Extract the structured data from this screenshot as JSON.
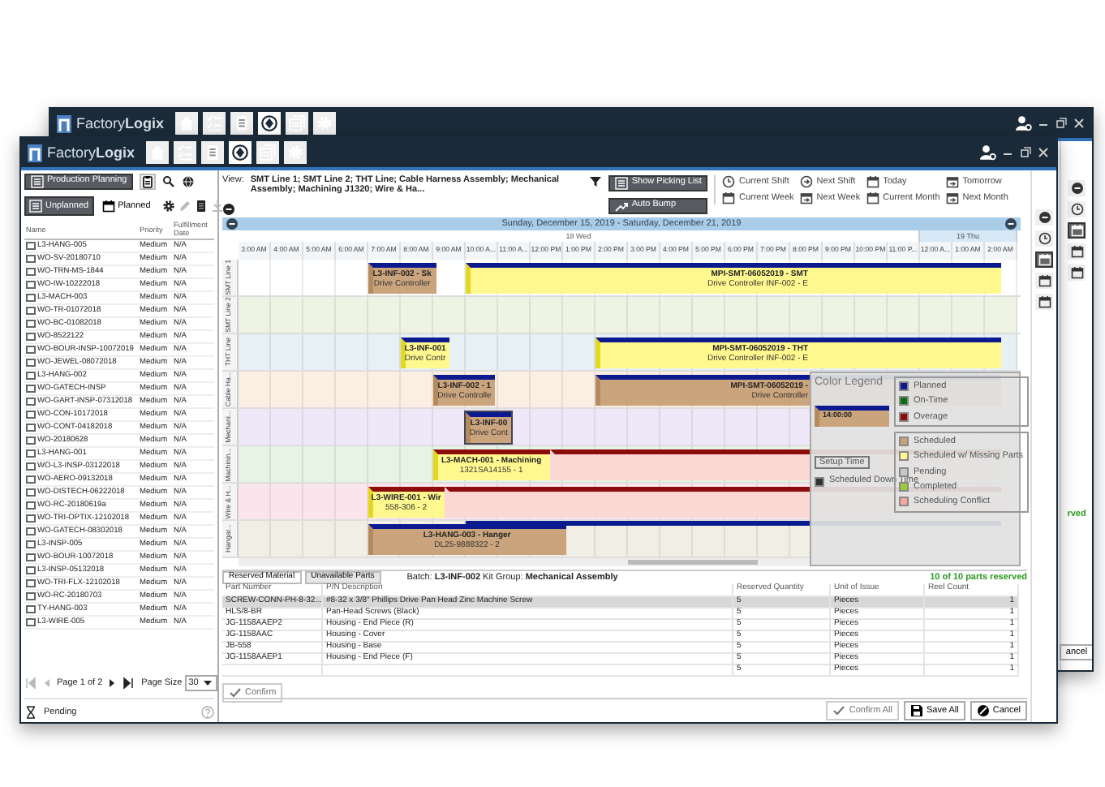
{
  "back_window": {
    "logo": "Factory**Logix**",
    "nav_icons": [
      {
        "kind": "home",
        "selected": false
      },
      {
        "kind": "checklist",
        "selected": false
      },
      {
        "kind": "document",
        "selected": false
      },
      {
        "kind": "planning",
        "selected": true
      },
      {
        "kind": "windows",
        "selected": false
      },
      {
        "kind": "gear",
        "selected": false
      }
    ],
    "side_icons": [
      {
        "kind": "collapse",
        "selected": false
      },
      {
        "kind": "clock",
        "selected": false
      },
      {
        "kind": "calendar",
        "selected": true
      },
      {
        "kind": "calendar",
        "selected": false
      },
      {
        "kind": "calendar",
        "selected": false
      }
    ],
    "status_fragment": "rved",
    "cancel_fragment": "ancel"
  },
  "window": {
    "logo": "Factory**Logix**",
    "nav_icons": [
      {
        "kind": "home",
        "selected": false
      },
      {
        "kind": "checklist",
        "selected": false
      },
      {
        "kind": "document",
        "selected": false
      },
      {
        "kind": "planning",
        "selected": true
      },
      {
        "kind": "windows",
        "selected": false
      },
      {
        "kind": "gear",
        "selected": false
      }
    ],
    "side_icons": [
      {
        "kind": "collapse",
        "selected": false
      },
      {
        "kind": "clock",
        "selected": false
      },
      {
        "kind": "calendar",
        "selected": true
      },
      {
        "kind": "calendar",
        "selected": false
      },
      {
        "kind": "calendar",
        "selected": false
      }
    ]
  },
  "left_panel": {
    "mode_button": "Production Planning",
    "tabs": [
      {
        "label": "Unplanned",
        "selected": true
      },
      {
        "label": "Planned",
        "selected": false
      }
    ],
    "tools": [
      {
        "kind": "gear",
        "disabled": false
      },
      {
        "kind": "pencil",
        "disabled": true
      },
      {
        "kind": "document",
        "disabled": false
      },
      {
        "kind": "download",
        "disabled": true
      }
    ],
    "columns": [
      "Name",
      "Priority",
      "Fulfillment Date"
    ],
    "rows": [
      {
        "name": "L3-HANG-005",
        "priority": "Medium",
        "date": "N/A",
        "checked": false
      },
      {
        "name": "WO-SV-20180710",
        "priority": "Medium",
        "date": "N/A",
        "checked": false
      },
      {
        "name": "WO-TRN-MS-1844",
        "priority": "Medium",
        "date": "N/A",
        "checked": false
      },
      {
        "name": "WO-IW-10222018",
        "priority": "Medium",
        "date": "N/A",
        "checked": false
      },
      {
        "name": "L3-MACH-003",
        "priority": "Medium",
        "date": "N/A",
        "checked": false
      },
      {
        "name": "WO-TR-01072018",
        "priority": "Medium",
        "date": "N/A",
        "checked": false
      },
      {
        "name": "WO-BC-01082018",
        "priority": "Medium",
        "date": "N/A",
        "checked": false
      },
      {
        "name": "WO-8522122",
        "priority": "Medium",
        "date": "N/A",
        "checked": false
      },
      {
        "name": "WO-BOUR-INSP-10072019",
        "priority": "Medium",
        "date": "N/A",
        "checked": false
      },
      {
        "name": "WO-JEWEL-08072018",
        "priority": "Medium",
        "date": "N/A",
        "checked": false
      },
      {
        "name": "L3-HANG-002",
        "priority": "Medium",
        "date": "N/A",
        "checked": false
      },
      {
        "name": "WO-GATECH-INSP",
        "priority": "Medium",
        "date": "N/A",
        "checked": false
      },
      {
        "name": "WO-GART-INSP-07312018",
        "priority": "Medium",
        "date": "N/A",
        "checked": false
      },
      {
        "name": "WO-CON-10172018",
        "priority": "Medium",
        "date": "N/A",
        "checked": false
      },
      {
        "name": "WO-CONT-04182018",
        "priority": "Medium",
        "date": "N/A",
        "checked": false
      },
      {
        "name": "WO-20180628",
        "priority": "Medium",
        "date": "N/A",
        "checked": false
      },
      {
        "name": "L3-HANG-001",
        "priority": "Medium",
        "date": "N/A",
        "checked": false
      },
      {
        "name": "WO-L3-INSP-03122018",
        "priority": "Medium",
        "date": "N/A",
        "checked": false
      },
      {
        "name": "WO-AERO-09132018",
        "priority": "Medium",
        "date": "N/A",
        "checked": false
      },
      {
        "name": "WO-DISTECH-06222018",
        "priority": "Medium",
        "date": "N/A",
        "checked": false
      },
      {
        "name": "WO-RC-20180619a",
        "priority": "Medium",
        "date": "N/A",
        "checked": false
      },
      {
        "name": "WO-TRI-OPTIX-12102018",
        "priority": "Medium",
        "date": "N/A",
        "checked": false
      },
      {
        "name": "WO-GATECH-08302018",
        "priority": "Medium",
        "date": "N/A",
        "checked": false
      },
      {
        "name": "L3-INSP-005",
        "priority": "Medium",
        "date": "N/A",
        "checked": false
      },
      {
        "name": "WO-BOUR-10072018",
        "priority": "Medium",
        "date": "N/A",
        "checked": false
      },
      {
        "name": "L3-INSP-05132018",
        "priority": "Medium",
        "date": "N/A",
        "checked": false
      },
      {
        "name": "WO-TRI-FLX-12102018",
        "priority": "Medium",
        "date": "N/A",
        "checked": false
      },
      {
        "name": "WO-RC-20180703",
        "priority": "Medium",
        "date": "N/A",
        "checked": false
      },
      {
        "name": "TY-HANG-003",
        "priority": "Medium",
        "date": "N/A",
        "checked": false
      },
      {
        "name": "L3-WIRE-005",
        "priority": "Medium",
        "date": "N/A",
        "checked": false
      }
    ],
    "pager": "Page 1 of 2",
    "page_size_label": "Page Size",
    "page_size": "30",
    "pending": "Pending"
  },
  "toolbar": {
    "view_label": "View:",
    "view_value": "SMT Line 1; SMT Line 2; THT Line; Cable Harness Assembly; Mechanical Assembly; Machining J1320; Wire & Ha...",
    "buttons": [
      {
        "label": "Show Picking List",
        "kind": "list"
      },
      {
        "label": "Auto Bump",
        "kind": "bump"
      }
    ],
    "ranges": [
      {
        "label": "Current Shift",
        "kind": "clock"
      },
      {
        "label": "Next Shift",
        "kind": "clock-next"
      },
      {
        "label": "Today",
        "kind": "calendar"
      },
      {
        "label": "Tomorrow",
        "kind": "calendar-next"
      },
      {
        "label": "Current Week",
        "kind": "calendar"
      },
      {
        "label": "Next Week",
        "kind": "calendar-next"
      },
      {
        "label": "Current Month",
        "kind": "calendar"
      },
      {
        "label": "Next Month",
        "kind": "calendar-next"
      }
    ]
  },
  "gantt": {
    "range": "Sunday, December 15, 2019 - Saturday, December 21, 2019",
    "days": [
      {
        "label": "18 Wed"
      },
      {
        "label": "19 Thu"
      }
    ],
    "hours": [
      "3:00 AM",
      "4:00 AM",
      "5:00 AM",
      "6:00 AM",
      "7:00 AM",
      "8:00 AM",
      "9:00 AM",
      "10:00 A...",
      "11:00 A...",
      "12:00 PM",
      "1:00 PM",
      "2:00 PM",
      "3:00 PM",
      "4:00 PM",
      "5:00 PM",
      "6:00 PM",
      "7:00 PM",
      "8:00 PM",
      "9:00 PM",
      "10:00 PM",
      "11:00 P...",
      "12:00 A...",
      "1:00 AM",
      "2:00 AM"
    ],
    "lanes": [
      {
        "label": "SMT Line 1",
        "color": "#ffffff",
        "tasks": [
          {
            "title": "L3-INF-002 - Sk",
            "subtitle": "Drive Controller",
            "kind": "scheduled",
            "color": "#0b1b8f",
            "selected": false
          },
          {
            "title": "MPI-SMT-06052019 - SMT",
            "subtitle": "Drive Controller INF-002 - E",
            "kind": "missing_parts",
            "color": "#0b1b8f",
            "selected": false
          }
        ]
      },
      {
        "label": "SMT Line 2",
        "color": "#eef3e4"
      },
      {
        "label": "THT Line",
        "color": "#e7f0f5",
        "tasks": [
          {
            "title": "L3-INF-001",
            "subtitle": "Drive Contr",
            "kind": "missing_parts",
            "color": "#0b1b8f",
            "selected": false
          },
          {
            "title": "MPI-SMT-06052019 - THT",
            "subtitle": "Drive Controller INF-002 - E",
            "kind": "missing_parts",
            "color": "#0b1b8f",
            "selected": false
          }
        ]
      },
      {
        "label": "Cable Ha...",
        "color": "#fbeee3",
        "tasks": [
          {
            "title": "L3-INF-002 - 1",
            "subtitle": "Drive Controlle",
            "kind": "scheduled",
            "color": "#0b1b8f",
            "selected": false
          },
          {
            "title": "MPI-SMT-06052019 -",
            "subtitle": "Drive Controller",
            "kind": "scheduled",
            "color": "#0b1b8f",
            "selected": false
          }
        ]
      },
      {
        "label": "Mechani...",
        "color": "#efe8f8",
        "tasks": [
          {
            "title": "L3-INF-00",
            "subtitle": "Drive Cont",
            "kind": "scheduled",
            "color": "#0b1b8f",
            "selected": true
          }
        ]
      },
      {
        "label": "Machinin...",
        "color": "#e5f4e4",
        "tasks": [
          {
            "title": "L3-MACH-001 - Machining",
            "subtitle": "1321SA14155 - 1",
            "kind": "missing_parts",
            "color": "#8e0b0b",
            "selected": false
          },
          {
            "kind": "conflict",
            "color": "#8e0b0b",
            "selected": false
          }
        ]
      },
      {
        "label": "Wire & H...",
        "color": "#fbe5ec",
        "tasks": [
          {
            "title": "L3-WIRE-001 - Wir",
            "subtitle": "558-306 - 2",
            "kind": "missing_parts",
            "color": "#8e0b0b",
            "selected": false
          },
          {
            "kind": "conflict",
            "color": "#8e0b0b",
            "selected": false
          }
        ]
      },
      {
        "label": "Hangar...",
        "color": "#f1eee6",
        "tasks": [
          {
            "kind": "band",
            "color": "#0b1b8f",
            "selected": false
          },
          {
            "title": "L3-HANG-003 - Hanger",
            "subtitle": "DL25-9888322 - 2",
            "kind": "scheduled",
            "color": "#0b1b8f",
            "selected": false
          }
        ]
      }
    ],
    "legend": {
      "title": "Color Legend",
      "sample_time": "14:00:00",
      "setup": "Setup Time",
      "down_time": "Scheduled Down Time",
      "groups": [
        {
          "items": [
            {
              "label": "Planned",
              "color": "#0b1b8f"
            },
            {
              "label": "On-Time",
              "color": "#0b6e12"
            },
            {
              "label": "Overage",
              "color": "#8e0b0b"
            }
          ]
        },
        {
          "items": [
            {
              "label": "Scheduled",
              "color": "#c9a27a"
            },
            {
              "label": "Scheduled w/ Missing Parts",
              "color": "#fff68c"
            },
            {
              "label": "Pending",
              "color": "#c8c8c8"
            },
            {
              "label": "Completed",
              "color": "#9acd32"
            },
            {
              "label": "Scheduling Conflict",
              "color": "#f6a9a0"
            }
          ]
        }
      ]
    }
  },
  "bottom": {
    "tabs": [
      {
        "label": "Reserved Material",
        "selected": true
      },
      {
        "label": "Unavailable Parts",
        "selected": false
      }
    ],
    "batch": "Batch: **L3-INF-002** Kit Group: **Mechanical Assembly**",
    "reserved_status": "10 of 10 parts reserved",
    "columns": [
      "Part Number",
      "P/N Description",
      "Reserved Quantity",
      "Unit of Issue",
      "Reel Count"
    ],
    "rows": [
      {
        "part": "SCREW-CONN-PH-8-32...",
        "description": "#8-32 x 3/8\" Phillips Drive Pan Head Zinc Machine Screw",
        "quantity": "5",
        "unit": "Pieces",
        "reel": "1",
        "selected": true
      },
      {
        "part": "HLS/8-BR",
        "description": "Pan-Head Screws (Black)",
        "quantity": "5",
        "unit": "Pieces",
        "reel": "1",
        "selected": false
      },
      {
        "part": "JG-1158AAEP2",
        "description": "Housing - End Piece (R)",
        "quantity": "5",
        "unit": "Pieces",
        "reel": "1",
        "selected": false
      },
      {
        "part": "JG-1158AAC",
        "description": "Housing - Cover",
        "quantity": "5",
        "unit": "Pieces",
        "reel": "1",
        "selected": false
      },
      {
        "part": "JB-558",
        "description": "Housing - Base",
        "quantity": "5",
        "unit": "Pieces",
        "reel": "1",
        "selected": false
      },
      {
        "part": "JG-1158AAEP1",
        "description": "Housing - End Piece (F)",
        "quantity": "5",
        "unit": "Pieces",
        "reel": "1",
        "selected": false
      },
      {
        "quantity": "5",
        "unit": "Pieces",
        "reel": "1",
        "selected": false
      }
    ],
    "confirm": {
      "label": "Confirm",
      "disabled": true
    }
  },
  "footer_buttons": [
    {
      "label": "Confirm All",
      "kind": "check",
      "disabled": true
    },
    {
      "label": "Save All",
      "kind": "save",
      "disabled": false
    },
    {
      "label": "Cancel",
      "kind": "cancel",
      "disabled": false
    }
  ]
}
